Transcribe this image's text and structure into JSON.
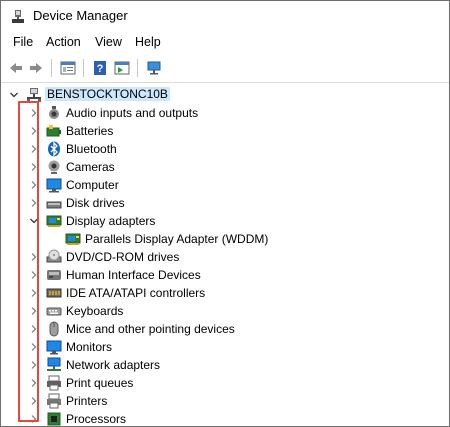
{
  "window": {
    "title": "Device Manager"
  },
  "menu": [
    "File",
    "Action",
    "View",
    "Help"
  ],
  "toolbar": {
    "icons": [
      "back-arrow-icon",
      "forward-arrow-icon",
      "properties-icon",
      "help-icon",
      "toggle-pane-icon",
      "scan-monitor-icon"
    ]
  },
  "tree": {
    "root": {
      "label": "BENSTOCKTONC10B",
      "icon": "computer-network-icon",
      "expanded": true
    },
    "items": [
      {
        "label": "Audio inputs and outputs",
        "icon": "speaker-icon",
        "expanded": false
      },
      {
        "label": "Batteries",
        "icon": "battery-icon",
        "expanded": false
      },
      {
        "label": "Bluetooth",
        "icon": "bluetooth-icon",
        "expanded": false
      },
      {
        "label": "Cameras",
        "icon": "camera-icon",
        "expanded": false
      },
      {
        "label": "Computer",
        "icon": "computer-icon",
        "expanded": false
      },
      {
        "label": "Disk drives",
        "icon": "disk-drive-icon",
        "expanded": false
      },
      {
        "label": "Display adapters",
        "icon": "display-adapter-icon",
        "expanded": true,
        "children": [
          {
            "label": "Parallels Display Adapter (WDDM)",
            "icon": "display-adapter-icon"
          }
        ]
      },
      {
        "label": "DVD/CD-ROM drives",
        "icon": "dvd-icon",
        "expanded": false
      },
      {
        "label": "Human Interface Devices",
        "icon": "hid-icon",
        "expanded": false
      },
      {
        "label": "IDE ATA/ATAPI controllers",
        "icon": "ide-controller-icon",
        "expanded": false
      },
      {
        "label": "Keyboards",
        "icon": "keyboard-icon",
        "expanded": false
      },
      {
        "label": "Mice and other pointing devices",
        "icon": "mouse-icon",
        "expanded": false
      },
      {
        "label": "Monitors",
        "icon": "monitor-icon",
        "expanded": false
      },
      {
        "label": "Network adapters",
        "icon": "network-adapter-icon",
        "expanded": false
      },
      {
        "label": "Print queues",
        "icon": "print-queue-icon",
        "expanded": false
      },
      {
        "label": "Printers",
        "icon": "printer-icon",
        "expanded": false
      },
      {
        "label": "Processors",
        "icon": "processor-icon",
        "expanded": false
      }
    ]
  },
  "colors": {
    "highlight_box": "#e8463c",
    "selection": "#cce8ff"
  }
}
